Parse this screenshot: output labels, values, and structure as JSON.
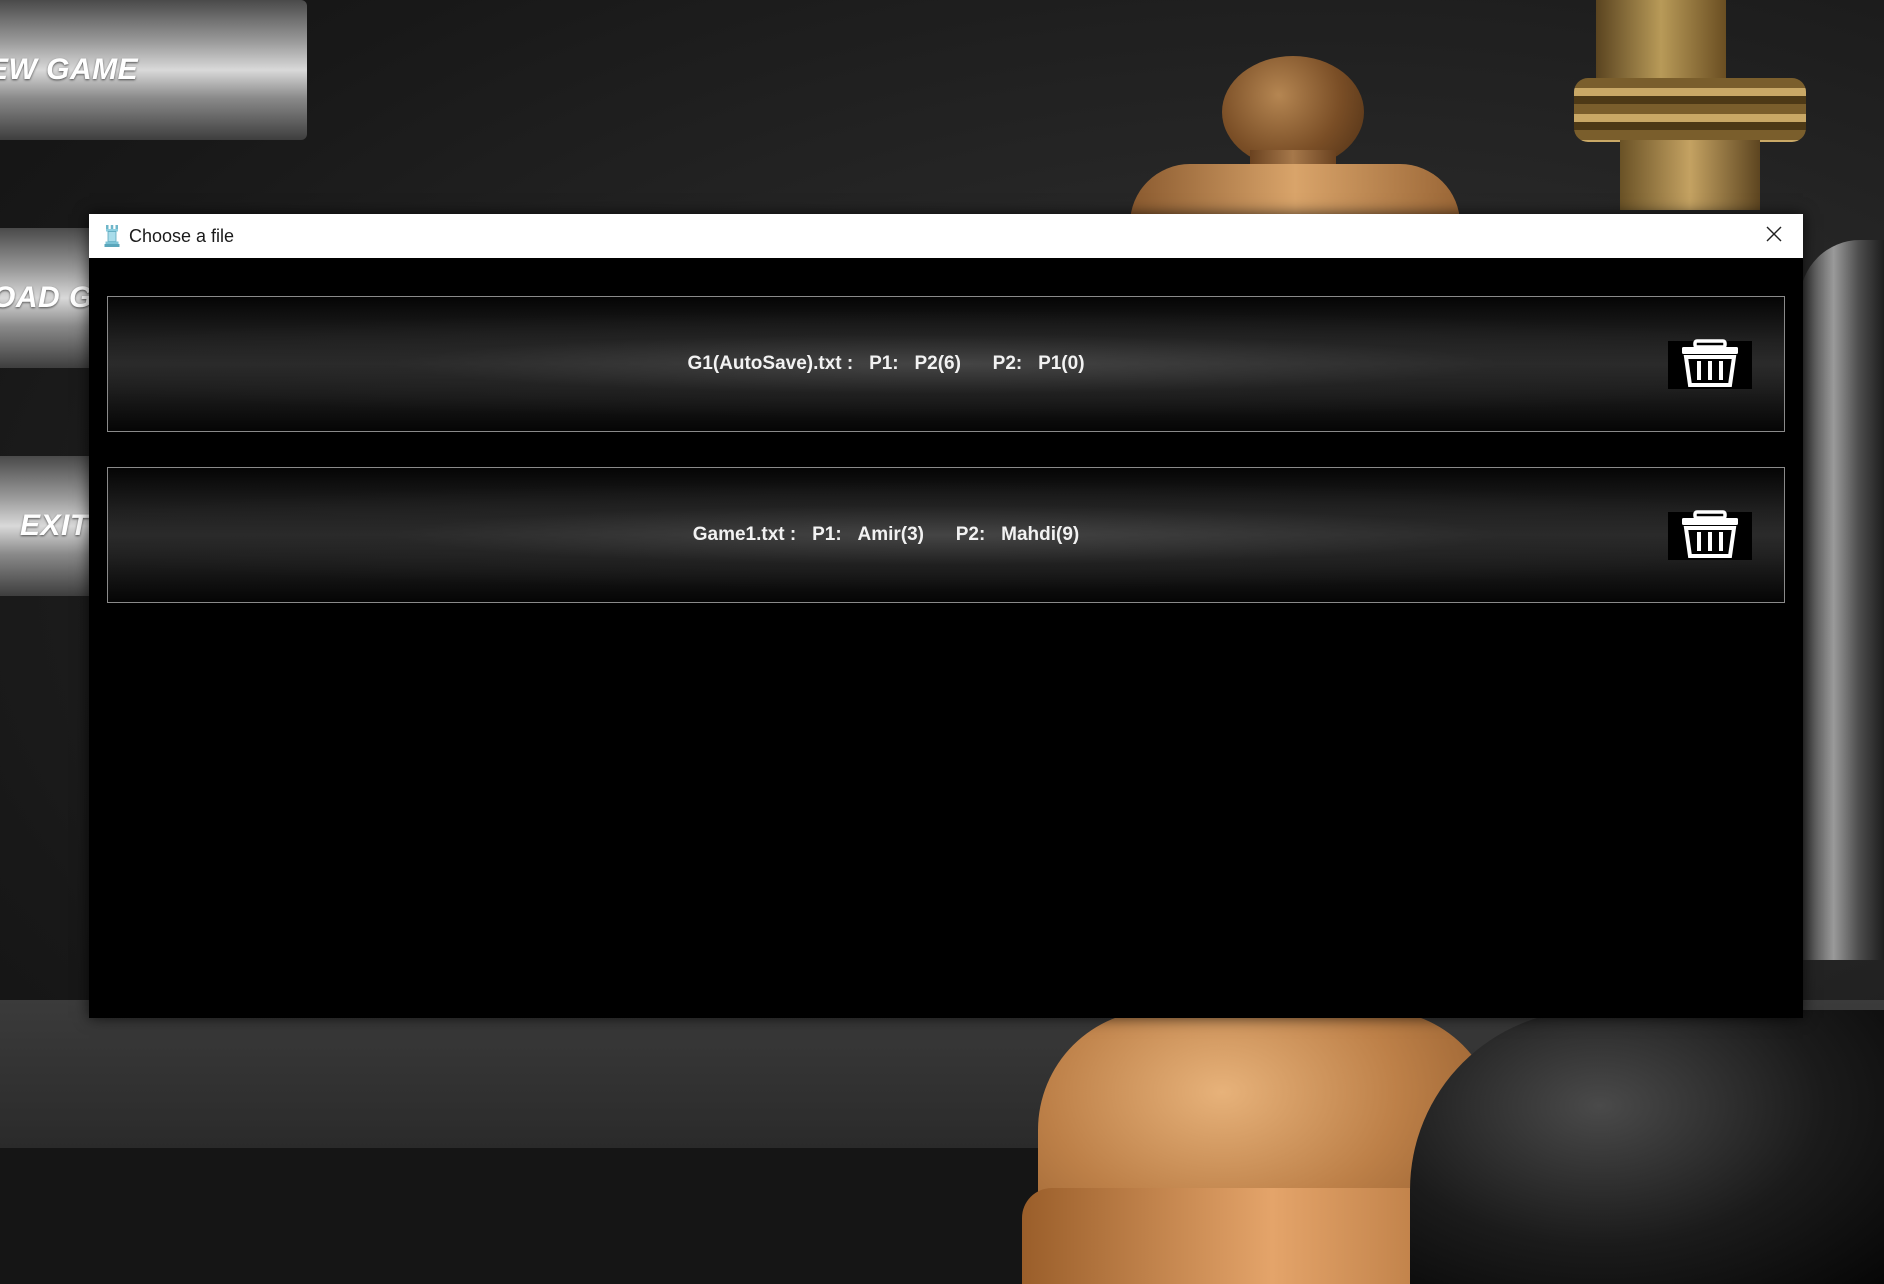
{
  "menu": {
    "new_game_label": "EW GAME",
    "load_game_label": "OAD GA",
    "exit_label": "EXIT"
  },
  "dialog": {
    "title": "Choose a file",
    "title_icon": "chess-rook-icon",
    "close_icon": "close-icon"
  },
  "files": [
    {
      "name": "G1(AutoSave).txt :",
      "p1_label": "P1:",
      "p1_value": "P2(6)",
      "p2_label": "P2:",
      "p2_value": "P1(0)",
      "delete_icon": "trash-icon"
    },
    {
      "name": "Game1.txt :",
      "p1_label": "P1:",
      "p1_value": "Amir(3)",
      "p2_label": "P2:",
      "p2_value": "Mahdi(9)",
      "delete_icon": "trash-icon"
    }
  ],
  "colors": {
    "dialog_background": "#000000",
    "titlebar_background": "#ffffff",
    "row_border": "#8a8a8a",
    "row_text": "#f2f2f2"
  }
}
